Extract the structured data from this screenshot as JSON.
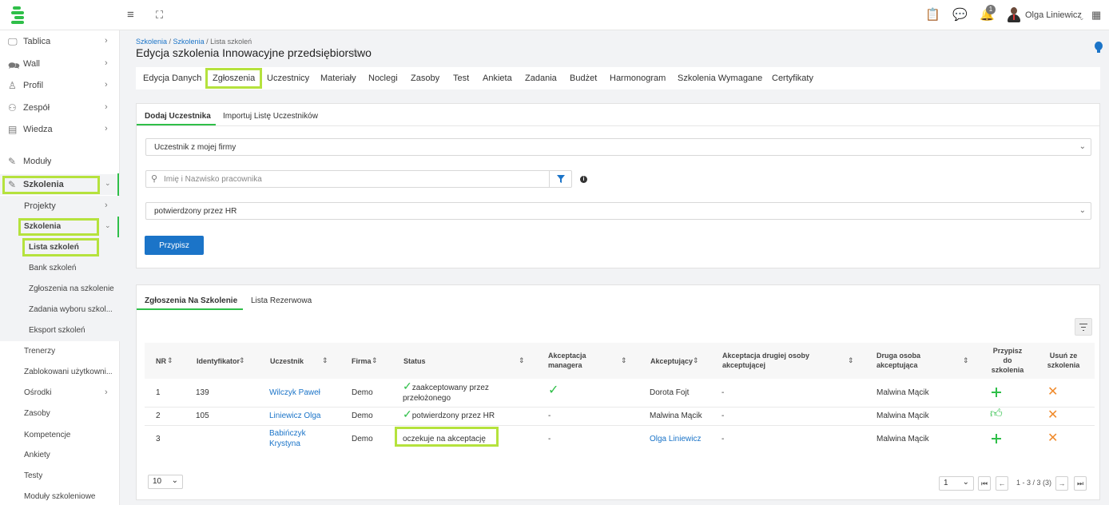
{
  "topbar": {
    "user_name": "Olga Liniewicz",
    "notification_count": "1"
  },
  "sidebar": {
    "items": [
      {
        "label": "Tablica"
      },
      {
        "label": "Wall"
      },
      {
        "label": "Profil"
      },
      {
        "label": "Zespół"
      },
      {
        "label": "Wiedza"
      },
      {
        "label": "Moduły"
      },
      {
        "label": "Szkolenia"
      },
      {
        "label": "Projekty"
      },
      {
        "label": "Szkolenia"
      },
      {
        "label": "Lista szkoleń"
      },
      {
        "label": "Bank szkoleń"
      },
      {
        "label": "Zgłoszenia na szkolenie"
      },
      {
        "label": "Zadania wyboru szkol..."
      },
      {
        "label": "Eksport szkoleń"
      },
      {
        "label": "Trenerzy"
      },
      {
        "label": "Zablokowani użytkowni..."
      },
      {
        "label": "Ośrodki"
      },
      {
        "label": "Zasoby"
      },
      {
        "label": "Kompetencje"
      },
      {
        "label": "Ankiety"
      },
      {
        "label": "Testy"
      },
      {
        "label": "Moduły szkoleniowe"
      }
    ]
  },
  "breadcrumb": {
    "part1": "Szkolenia",
    "sep1": " / ",
    "part2": "Szkolenia",
    "sep2": " / ",
    "part3": "Lista szkoleń"
  },
  "page_title": "Edycja szkolenia Innowacyjne przedsiębiorstwo",
  "tabs": [
    "Edycja Danych",
    "Zgłoszenia",
    "Uczestnicy",
    "Materiały",
    "Noclegi",
    "Zasoby",
    "Test",
    "Ankieta",
    "Zadania",
    "Budżet",
    "Harmonogram",
    "Szkolenia Wymagane",
    "Certyfikaty"
  ],
  "add_panel": {
    "subtabs": [
      "Dodaj Uczestnika",
      "Importuj Listę Uczestników"
    ],
    "source_select": "Uczestnik z mojej firmy",
    "search_placeholder": "Imię i Nazwisko pracownika",
    "status_select": "potwierdzony przez HR",
    "assign_button": "Przypisz"
  },
  "list_panel": {
    "subtabs": [
      "Zgłoszenia Na Szkolenie",
      "Lista Rezerwowa"
    ],
    "columns": {
      "nr": "NR",
      "id": "Identyfikator",
      "participant": "Uczestnik",
      "company": "Firma",
      "status": "Status",
      "mgr_accept_1": "Akceptacja",
      "mgr_accept_2": "managera",
      "acceptor": "Akceptujący",
      "second_accept_1": "Akceptacja drugiej osoby",
      "second_accept_2": "akceptującej",
      "second_person_1": "Druga osoba",
      "second_person_2": "akceptująca",
      "assign_1": "Przypisz",
      "assign_2": "do",
      "assign_3": "szkolenia",
      "remove_1": "Usuń ze",
      "remove_2": "szkolenia"
    },
    "rows": [
      {
        "nr": "1",
        "id": "139",
        "participant": "Wilczyk Paweł",
        "company": "Demo",
        "status_1": "zaakceptowany przez",
        "status_2": "przełożonego",
        "mgr": "",
        "acceptor": "Dorota Fojt",
        "second_accept": "-",
        "second_person": "Malwina Mącik"
      },
      {
        "nr": "2",
        "id": "105",
        "participant": "Liniewicz Olga",
        "company": "Demo",
        "status_1": "potwierdzony przez HR",
        "status_2": "",
        "mgr": "-",
        "acceptor": "Malwina Mącik",
        "second_accept": "-",
        "second_person": "Malwina Mącik"
      },
      {
        "nr": "3",
        "id": "",
        "participant_1": "Babińczyk",
        "participant_2": "Krystyna",
        "company": "Demo",
        "status_1": "oczekuje na akceptację",
        "status_2": "",
        "mgr": "-",
        "acceptor": "Olga Liniewicz",
        "second_accept": "-",
        "second_person": "Malwina Mącik"
      }
    ],
    "page_size": "10",
    "page_number": "1",
    "range": "1 - 3 / 3 (3)"
  },
  "colors": {
    "accent_green": "#2fbf49",
    "highlight": "#b5e23d",
    "primary_blue": "#1b74c8",
    "remove_orange": "#f08a2b"
  }
}
